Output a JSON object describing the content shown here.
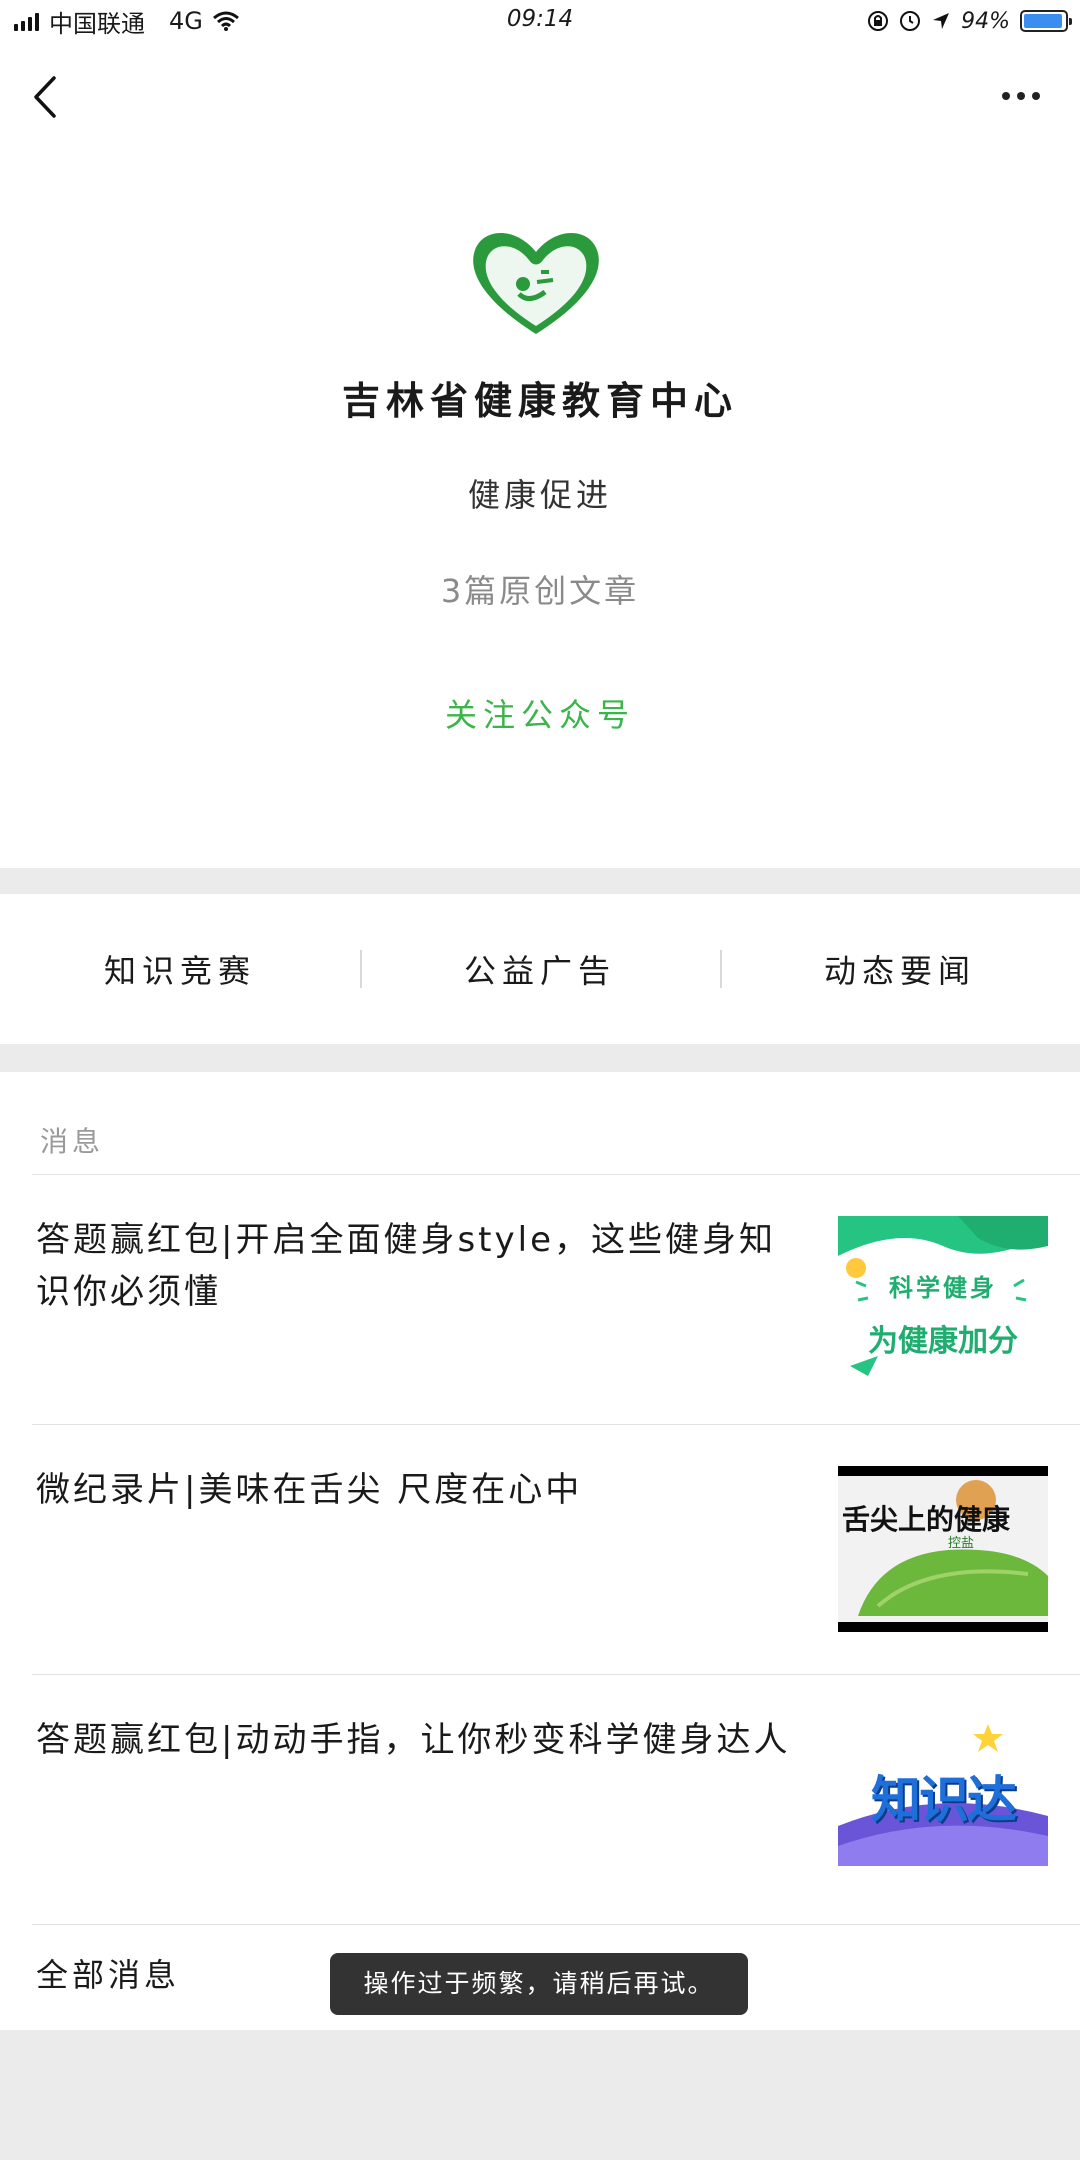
{
  "status_bar": {
    "carrier": "中国联通",
    "network": "4G",
    "time": "09:14",
    "battery": "94%",
    "battery_level": 0.94
  },
  "navbar": {
    "back_icon": "chevron-left-icon",
    "more_icon": "more-dots-icon"
  },
  "profile": {
    "name": "吉林省健康教育中心",
    "description": "健康促进",
    "original_count": "3篇原创文章",
    "follow_label": "关注公众号"
  },
  "menu": {
    "items": [
      {
        "label": "知识竞赛"
      },
      {
        "label": "公益广告"
      },
      {
        "label": "动态要闻"
      }
    ]
  },
  "messages": {
    "section_title": "消息",
    "articles": [
      {
        "title": "答题赢红包|开启全面健身style，这些健身知识你必须懂",
        "thumb_line1": "科学健身",
        "thumb_line2": "为健康加分"
      },
      {
        "title": "微纪录片|美味在舌尖  尺度在心中",
        "thumb_text": "舌尖上的健康",
        "thumb_sub": "控盐"
      },
      {
        "title": "答题赢红包|动动手指，让你秒变科学健身达人",
        "thumb_text": "知识达"
      }
    ],
    "all_label": "全部消息"
  },
  "toast": "操作过于频繁，请稍后再试。",
  "colors": {
    "accent_green": "#3bb54a",
    "background": "#ebebeb",
    "toast_bg": "#333333"
  }
}
